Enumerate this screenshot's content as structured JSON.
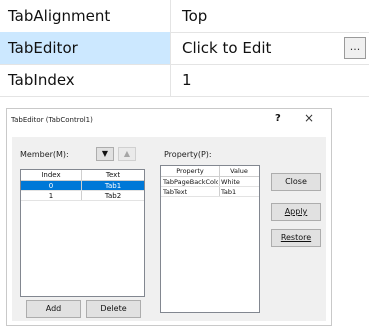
{
  "property_grid": {
    "rows": [
      {
        "name": "TabAlignment",
        "value": "Top"
      },
      {
        "name": "TabEditor",
        "value": "Click to Edit"
      },
      {
        "name": "TabIndex",
        "value": "1"
      }
    ],
    "ellipsis_label": "..."
  },
  "dialog": {
    "title": "TabEditor (TabControl1)",
    "help_label": "?",
    "close_label": "×",
    "member_label": "Member(M):",
    "move_down_label": "▼",
    "move_up_label": "▲",
    "member_columns": [
      "Index",
      "Text"
    ],
    "members": [
      {
        "index": "0",
        "text": "Tab1"
      },
      {
        "index": "1",
        "text": "Tab2"
      }
    ],
    "property_label": "Property(P):",
    "property_columns": [
      "Property",
      "Value"
    ],
    "properties": [
      {
        "name": "TabPageBackColor",
        "value": "White"
      },
      {
        "name": "TabText",
        "value": "Tab1"
      }
    ],
    "buttons": {
      "close": "Close",
      "apply": "Apply",
      "restore": "Restore",
      "add": "Add",
      "delete": "Delete"
    }
  },
  "colors": {
    "selection_light": "#cce8ff",
    "selection_dark": "#0078d7"
  }
}
